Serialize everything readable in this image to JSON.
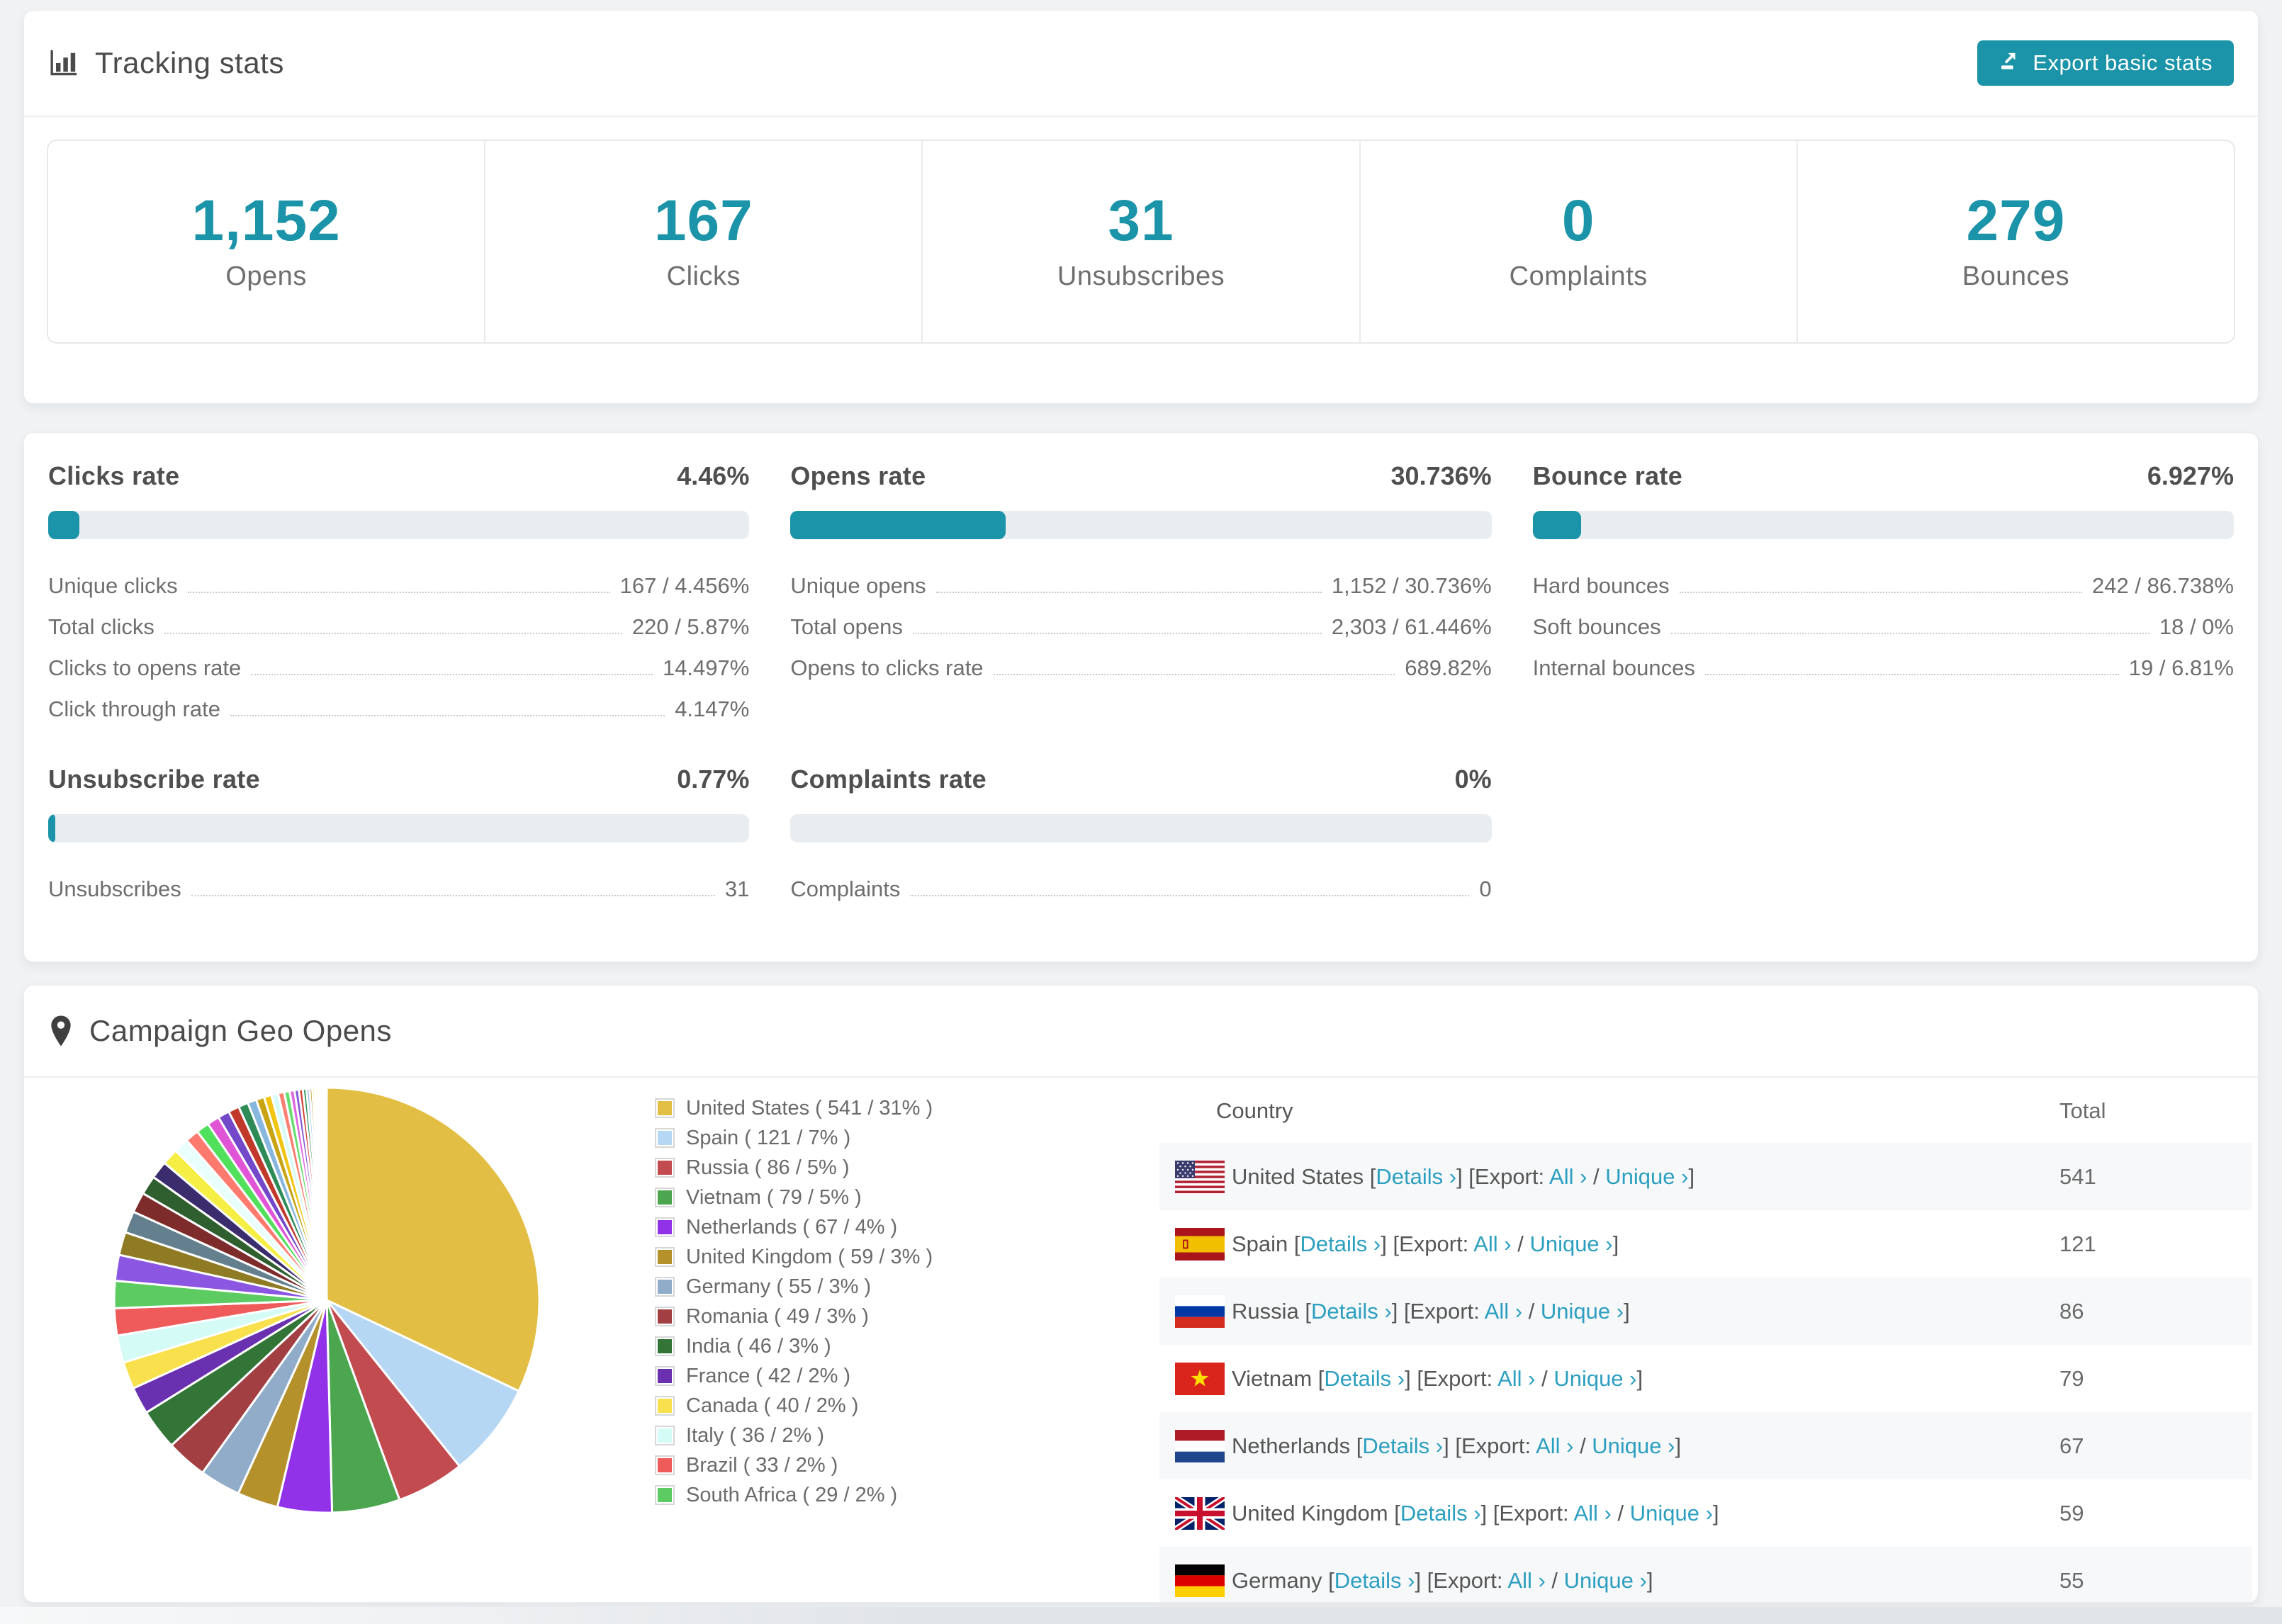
{
  "colors": {
    "accent": "#1b93a8",
    "link": "#2c9fc0",
    "track": "#eaedf0",
    "page_background": "#f0f2f4"
  },
  "header": {
    "title": "Tracking stats",
    "title_icon": "bar-chart-icon",
    "export_label": "Export basic stats",
    "export_icon": "export-icon"
  },
  "summary": [
    {
      "value": "1,152",
      "label": "Opens"
    },
    {
      "value": "167",
      "label": "Clicks"
    },
    {
      "value": "31",
      "label": "Unsubscribes"
    },
    {
      "value": "0",
      "label": "Complaints"
    },
    {
      "value": "279",
      "label": "Bounces"
    }
  ],
  "rates": [
    {
      "title": "Clicks rate",
      "value": "4.46%",
      "percent": 4.46,
      "rows": [
        {
          "label": "Unique clicks",
          "value": "167 / 4.456%"
        },
        {
          "label": "Total clicks",
          "value": "220 / 5.87%"
        },
        {
          "label": "Clicks to opens rate",
          "value": "14.497%"
        },
        {
          "label": "Click through rate",
          "value": "4.147%"
        }
      ]
    },
    {
      "title": "Opens rate",
      "value": "30.736%",
      "percent": 30.736,
      "rows": [
        {
          "label": "Unique opens",
          "value": "1,152 / 30.736%"
        },
        {
          "label": "Total opens",
          "value": "2,303 / 61.446%"
        },
        {
          "label": "Opens to clicks rate",
          "value": "689.82%"
        }
      ]
    },
    {
      "title": "Bounce rate",
      "value": "6.927%",
      "percent": 6.927,
      "rows": [
        {
          "label": "Hard bounces",
          "value": "242 / 86.738%"
        },
        {
          "label": "Soft bounces",
          "value": "18 / 0%"
        },
        {
          "label": "Internal bounces",
          "value": "19 / 6.81%"
        }
      ]
    },
    {
      "title": "Unsubscribe rate",
      "value": "0.77%",
      "percent": 0.77,
      "rows": [
        {
          "label": "Unsubscribes",
          "value": "31"
        }
      ]
    },
    {
      "title": "Complaints rate",
      "value": "0%",
      "percent": 0,
      "rows": [
        {
          "label": "Complaints",
          "value": "0"
        }
      ]
    }
  ],
  "geo": {
    "title": "Campaign Geo Opens",
    "title_icon": "map-pin-icon",
    "legend": [
      {
        "label": "United States ( 541 / 31% )",
        "color": "#e3be44"
      },
      {
        "label": "Spain ( 121 / 7% )",
        "color": "#b5d7f4"
      },
      {
        "label": "Russia ( 86 / 5% )",
        "color": "#c24b50"
      },
      {
        "label": "Vietnam ( 79 / 5% )",
        "color": "#4ca64f"
      },
      {
        "label": "Netherlands ( 67 / 4% )",
        "color": "#9232e8"
      },
      {
        "label": "United Kingdom ( 59 / 3% )",
        "color": "#b5912c"
      },
      {
        "label": "Germany ( 55 / 3% )",
        "color": "#90acc9"
      },
      {
        "label": "Romania ( 49 / 3% )",
        "color": "#a13f42"
      },
      {
        "label": "India ( 46 / 3% )",
        "color": "#337437"
      },
      {
        "label": "France ( 42 / 2% )",
        "color": "#6930af"
      },
      {
        "label": "Canada ( 40 / 2% )",
        "color": "#f9e04d"
      },
      {
        "label": "Italy ( 36 / 2% )",
        "color": "#d4fbf6"
      },
      {
        "label": "Brazil ( 33 / 2% )",
        "color": "#ef5b5b"
      },
      {
        "label": "South Africa ( 29 / 2% )",
        "color": "#5bcb62"
      }
    ],
    "table": {
      "columns": [
        "Country",
        "Total"
      ],
      "link_labels": {
        "details": "Details ›",
        "export_prefix": "Export:",
        "all": "All ›",
        "unique": "Unique ›"
      },
      "rows": [
        {
          "country": "United States",
          "flag": "us",
          "total": "541"
        },
        {
          "country": "Spain",
          "flag": "es",
          "total": "121"
        },
        {
          "country": "Russia",
          "flag": "ru",
          "total": "86"
        },
        {
          "country": "Vietnam",
          "flag": "vn",
          "total": "79"
        },
        {
          "country": "Netherlands",
          "flag": "nl",
          "total": "67"
        },
        {
          "country": "United Kingdom",
          "flag": "gb",
          "total": "59"
        },
        {
          "country": "Germany",
          "flag": "de",
          "total": "55"
        }
      ]
    }
  },
  "chart_data": {
    "type": "pie",
    "title": "Campaign Geo Opens",
    "legend_position": "right",
    "start_angle_deg": 0,
    "direction": "clockwise",
    "slices": [
      {
        "label": "United States",
        "opens": 541,
        "percent": 31,
        "color": "#e3be44"
      },
      {
        "label": "Spain",
        "opens": 121,
        "percent": 7,
        "color": "#b5d7f4"
      },
      {
        "label": "Russia",
        "opens": 86,
        "percent": 5,
        "color": "#c24b50"
      },
      {
        "label": "Vietnam",
        "opens": 79,
        "percent": 5,
        "color": "#4ca64f"
      },
      {
        "label": "Netherlands",
        "opens": 67,
        "percent": 4,
        "color": "#9232e8"
      },
      {
        "label": "United Kingdom",
        "opens": 59,
        "percent": 3,
        "color": "#b5912c"
      },
      {
        "label": "Germany",
        "opens": 55,
        "percent": 3,
        "color": "#90acc9"
      },
      {
        "label": "Romania",
        "opens": 49,
        "percent": 3,
        "color": "#a13f42"
      },
      {
        "label": "India",
        "opens": 46,
        "percent": 3,
        "color": "#337437"
      },
      {
        "label": "France",
        "opens": 42,
        "percent": 2,
        "color": "#6930af"
      },
      {
        "label": "Canada",
        "opens": 40,
        "percent": 2,
        "color": "#f9e04d"
      },
      {
        "label": "Italy",
        "opens": 36,
        "percent": 2,
        "color": "#d4fbf6"
      },
      {
        "label": "Brazil",
        "opens": 33,
        "percent": 2,
        "color": "#ef5b5b"
      },
      {
        "label": "South Africa",
        "opens": 29,
        "percent": 2,
        "color": "#5bcb62"
      }
    ],
    "other_unlabeled_slices": {
      "note": "fan of small unlabeled countries, ~26% combined, decreasing size",
      "values": [
        1.9,
        1.7,
        1.6,
        1.5,
        1.4,
        1.3,
        1.2,
        1.1,
        1.0,
        0.95,
        0.9,
        0.85,
        0.8,
        0.72,
        0.65,
        0.6,
        0.55,
        0.5,
        0.45,
        0.4,
        0.36,
        0.32,
        0.29,
        0.26,
        0.23,
        0.2,
        0.18,
        0.16,
        0.14,
        0.12,
        0.1,
        0.09,
        0.08,
        0.07,
        0.06,
        0.05
      ],
      "colors": [
        "#8a56e2",
        "#8f7b24",
        "#64808f",
        "#7d2b2b",
        "#2f5e2f",
        "#3b2c6e",
        "#f5ef45",
        "#e8fffb",
        "#ff7a6e",
        "#51e05c",
        "#e055d5",
        "#7348c9",
        "#c0392b",
        "#2e8b57",
        "#87b6de",
        "#c8a415",
        "#f1c40f",
        "#d7fcf7",
        "#fa8072",
        "#66de70",
        "#df6ae0",
        "#8659d8",
        "#d14233",
        "#35985e",
        "#9cc3e5",
        "#b5952d",
        "#f7ee4e",
        "#eafffc",
        "#ff8d80",
        "#5ce868",
        "#e96ee0",
        "#9b59b6",
        "#e74c3c",
        "#27ae60",
        "#5dade2",
        "#c3a020"
      ]
    }
  }
}
